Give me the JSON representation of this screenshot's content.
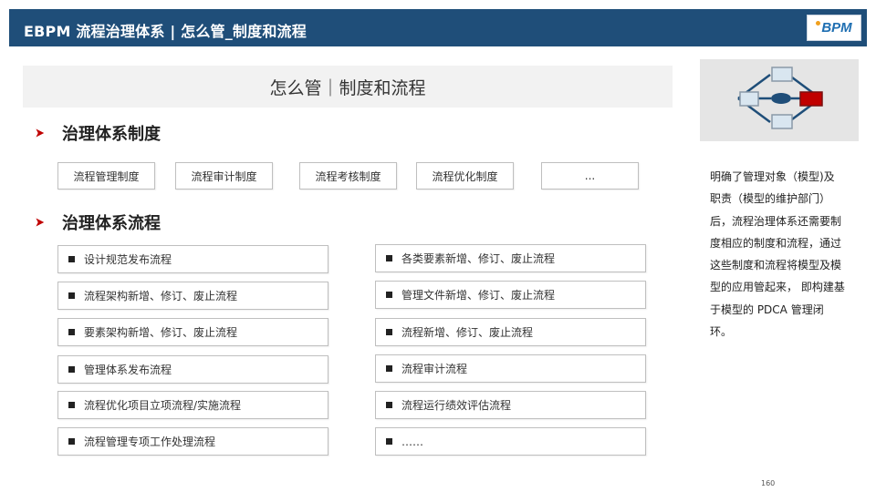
{
  "header": {
    "title": "EBPM 流程治理体系  |  怎么管_制度和流程",
    "logo_text": "BPM"
  },
  "title_band": {
    "text": "怎么管｜制度和流程"
  },
  "sections": {
    "policies": {
      "title": "治理体系制度",
      "items": [
        "流程管理制度",
        "流程审计制度",
        "流程考核制度",
        "流程优化制度",
        "..."
      ]
    },
    "processes": {
      "title": "治理体系流程",
      "left": [
        "设计规范发布流程",
        "流程架构新增、修订、废止流程",
        "要素架构新增、修订、废止流程",
        "管理体系发布流程",
        "流程优化项目立项流程/实施流程",
        "流程管理专项工作处理流程"
      ],
      "right": [
        "各类要素新增、修订、废止流程",
        "管理文件新增、修订、废止流程",
        "流程新增、修订、废止流程",
        "流程审计流程",
        "流程运行绩效评估流程",
        "……"
      ]
    }
  },
  "side_text": "明确了管理对象（模型)及职责（模型的维护部门）后，流程治理体系还需要制度相应的制度和流程，通过这些制度和流程将模型及模型的应用管起来，  即构建基于模型的 PDCA 管理闭环。",
  "page_number": "160",
  "colors": {
    "header_bg": "#1f4e79",
    "arrow": "#c00000",
    "accent_red": "#c00000",
    "diagram_blue": "#1f4e79"
  },
  "icons": {
    "section_marker": "arrow-right-icon",
    "list_marker": "square-bullet-icon",
    "diagram": "process-flow-diagram-icon"
  }
}
